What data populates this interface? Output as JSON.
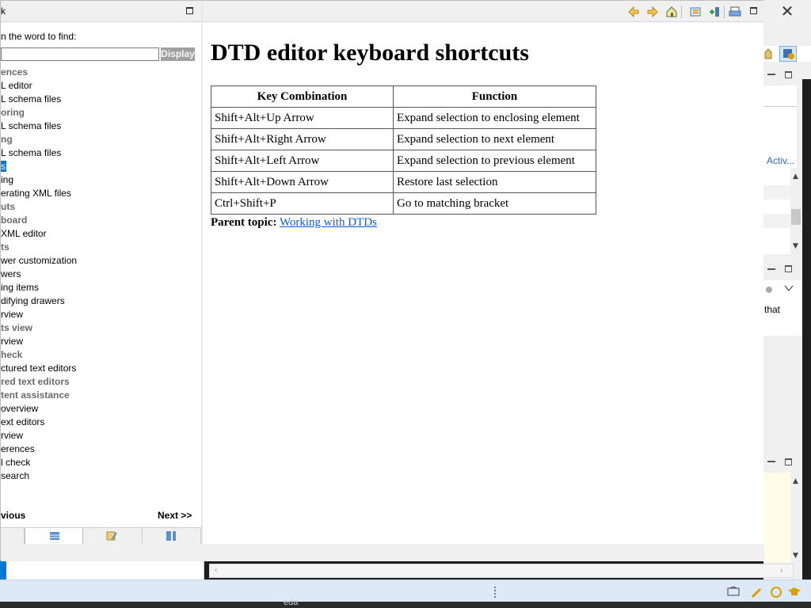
{
  "left_pane": {
    "title": "k",
    "search_label": "n the word to find:",
    "search_value": "",
    "display_button": "Display",
    "results": [
      {
        "text": "ences",
        "group": true
      },
      {
        "text": "L editor"
      },
      {
        "text": "L schema files"
      },
      {
        "text": "oring",
        "group": true
      },
      {
        "text": "L schema files"
      },
      {
        "text": "ng",
        "group": true
      },
      {
        "text": "L schema files"
      },
      {
        "text": "s",
        "selected": true
      },
      {
        "text": "ing"
      },
      {
        "text": "erating XML files"
      },
      {
        "text": "uts",
        "group": true
      },
      {
        "text": "board",
        "group": true
      },
      {
        "text": "XML editor"
      },
      {
        "text": "ts",
        "group": true
      },
      {
        "text": "wer customization"
      },
      {
        "text": "wers"
      },
      {
        "text": "ing items"
      },
      {
        "text": "difying drawers"
      },
      {
        "text": "rview"
      },
      {
        "text": "ts view",
        "group": true
      },
      {
        "text": "rview"
      },
      {
        "text": "heck",
        "group": true
      },
      {
        "text": "ctured text editors"
      },
      {
        "text": "red text editors",
        "group": true
      },
      {
        "text": "tent assistance",
        "group": true
      },
      {
        "text": "overview"
      },
      {
        "text": "ext editors"
      },
      {
        "text": "rview"
      },
      {
        "text": "erences"
      },
      {
        "text": "l check"
      },
      {
        "text": "search"
      }
    ],
    "previous_label": "vious",
    "next_label": "Next >>"
  },
  "content": {
    "title": "DTD editor keyboard shortcuts",
    "table": {
      "headers": [
        "Key Combination",
        "Function"
      ],
      "rows": [
        [
          "Shift+Alt+Up Arrow",
          "Expand selection to enclosing element"
        ],
        [
          "Shift+Alt+Right Arrow",
          "Expand selection to next element"
        ],
        [
          "Shift+Alt+Left Arrow",
          "Expand selection to previous element"
        ],
        [
          "Shift+Alt+Down Arrow",
          "Restore last selection"
        ],
        [
          "Ctrl+Shift+P",
          "Go to matching bracket"
        ]
      ]
    },
    "parent_topic_label": "Parent topic:",
    "parent_topic_link": "Working with DTDs"
  },
  "background": {
    "activity_label": "Activ...",
    "that_label": "that",
    "taskbar_text": "eda"
  },
  "colors": {
    "selection": "#0078d7",
    "link": "#0b5ed7",
    "toolbar_arrow": "#e8a000"
  }
}
